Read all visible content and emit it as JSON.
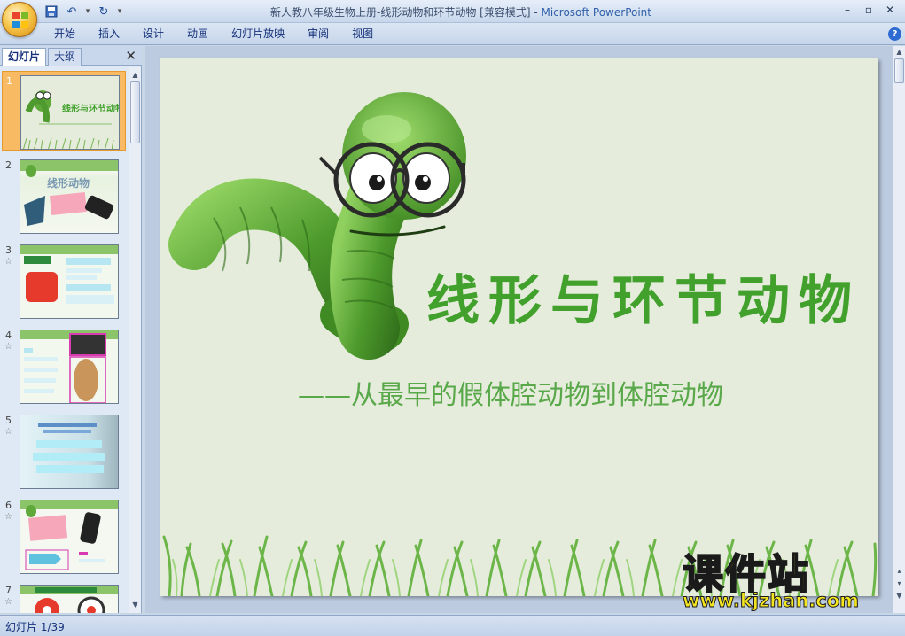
{
  "window": {
    "title": "新人教八年级生物上册-线形动物和环节动物 [兼容模式] - ",
    "app_name": "Microsoft PowerPoint"
  },
  "quick_access": {
    "icons": [
      "save-icon",
      "undo-icon",
      "dropdown-icon",
      "redo-icon",
      "customize-icon"
    ]
  },
  "ribbon": {
    "tabs": [
      "开始",
      "插入",
      "设计",
      "动画",
      "幻灯片放映",
      "审阅",
      "视图"
    ]
  },
  "left_pane": {
    "tabs": [
      "幻灯片",
      "大纲"
    ],
    "slides": [
      {
        "num": "1",
        "selected": true,
        "title": "线形与环节动物"
      },
      {
        "num": "2",
        "selected": false,
        "title": "线形动物"
      },
      {
        "num": "3",
        "selected": false,
        "title": ""
      },
      {
        "num": "4",
        "selected": false,
        "title": ""
      },
      {
        "num": "5",
        "selected": false,
        "title": ""
      },
      {
        "num": "6",
        "selected": false,
        "title": ""
      },
      {
        "num": "7",
        "selected": false,
        "title": ""
      }
    ]
  },
  "slide": {
    "title": "线形与环节动物",
    "subtitle": "——从最早的假体腔动物到体腔动物"
  },
  "status": {
    "slide_indicator": "幻灯片 1/39"
  },
  "watermark": {
    "main": "课件站",
    "url": "www.kjzhan.com"
  },
  "colors": {
    "title_green": "#41a12c",
    "slide_bg": "#e6ecdc",
    "selected_thumb": "#f8ba63"
  }
}
